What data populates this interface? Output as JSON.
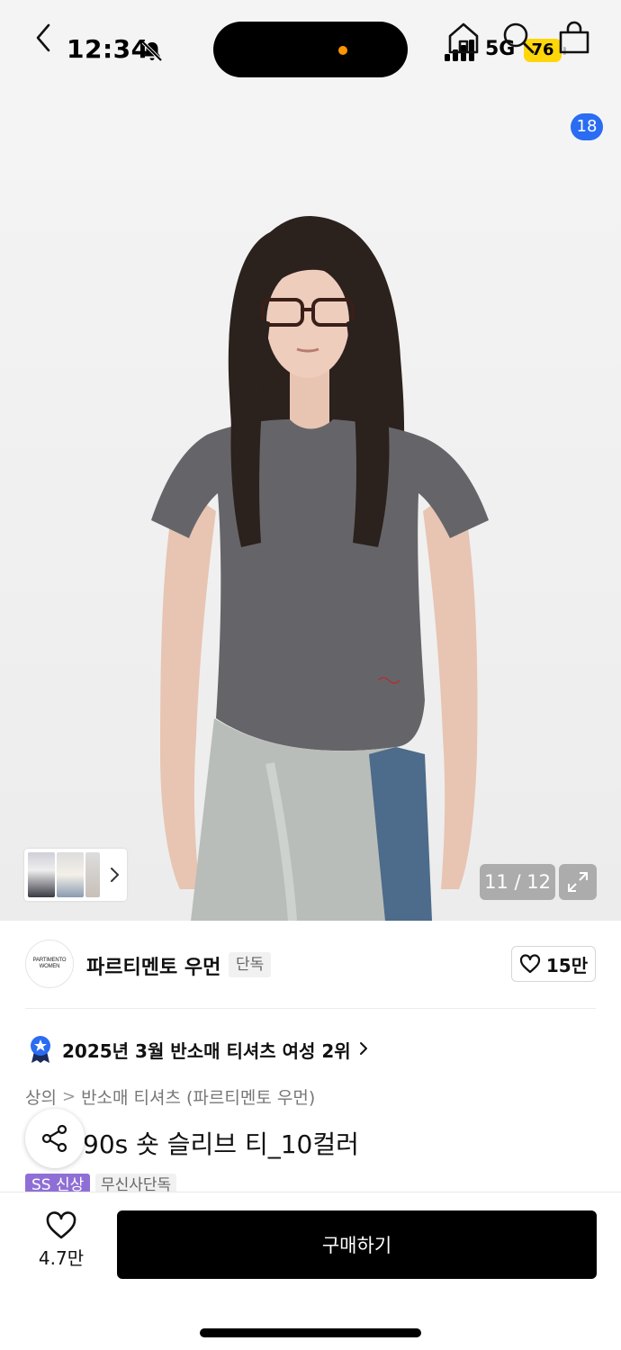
{
  "status_bar": {
    "time": "12:34",
    "network": "5G",
    "battery": "76",
    "icons": [
      "bell-slash-icon",
      "signal-icon",
      "battery-icon"
    ]
  },
  "nav": {
    "icons": [
      "back-chevron-icon",
      "home-icon",
      "search-icon",
      "shopping-bag-icon"
    ],
    "cart_count": "18"
  },
  "gallery": {
    "counter": "11 / 12",
    "current": 11,
    "total": 12,
    "icons": [
      "chevron-right-icon",
      "expand-icon"
    ]
  },
  "brand": {
    "logo_text_line1": "PARTIMENTO",
    "logo_text_line2": "WOMEN",
    "name": "파르티멘토 우먼",
    "tag": "단독",
    "likes": "15만"
  },
  "ranking": {
    "text": "2025년 3월 반소매 티셔츠 여성 2위"
  },
  "breadcrumb": {
    "category": "상의",
    "separator": ">",
    "subcategory": "반소매 티셔츠 (파르티멘토 우먼)"
  },
  "product": {
    "title_visible": "90s 숏 슬리브 티_10컬러",
    "tag_new": "SS 신상",
    "tag_exclusive": "무신사단독"
  },
  "bottom": {
    "wish_count": "4.7만",
    "buy_label": "구매하기"
  },
  "colors": {
    "cart_badge": "#2a6cf2",
    "new_tag": "#8f6fd6",
    "battery": "#ffd60a",
    "buy_button": "#000000"
  }
}
